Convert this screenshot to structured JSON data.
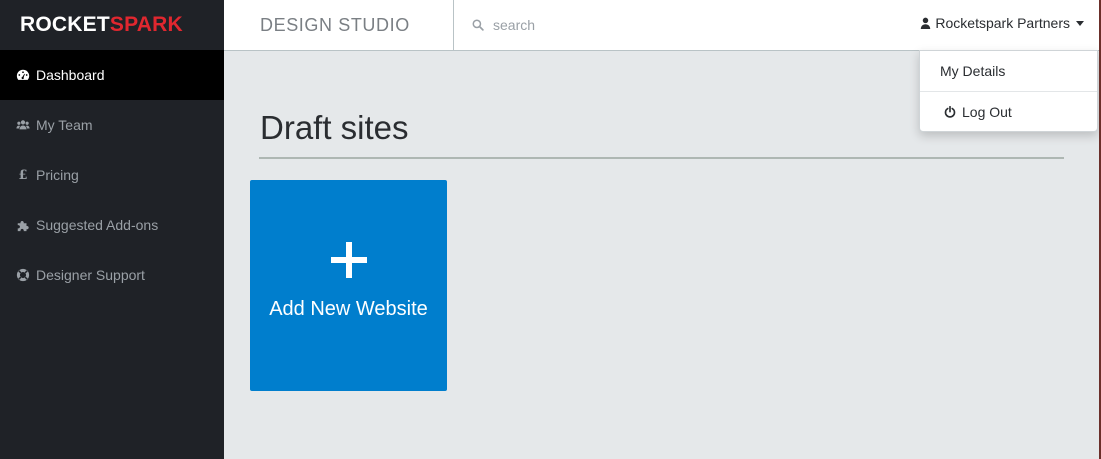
{
  "logo": {
    "part1": "ROCKET",
    "part2": "SPARK"
  },
  "sidebar": {
    "items": [
      {
        "label": "Dashboard",
        "icon": "dashboard-icon"
      },
      {
        "label": "My Team",
        "icon": "team-icon"
      },
      {
        "label": "Pricing",
        "icon": "pound-icon"
      },
      {
        "label": "Suggested Add-ons",
        "icon": "puzzle-icon"
      },
      {
        "label": "Designer Support",
        "icon": "lifebuoy-icon"
      }
    ]
  },
  "header": {
    "section_title": "DESIGN STUDIO",
    "search_placeholder": "search",
    "user_name": "Rocketspark Partners"
  },
  "dropdown": {
    "my_details": "My Details",
    "log_out": "Log Out"
  },
  "main": {
    "heading": "Draft sites",
    "add_card_label": "Add New Website"
  },
  "colors": {
    "sidebar_bg": "#1f2227",
    "brand_red": "#e0272f",
    "accent_blue": "#007ecd",
    "content_bg": "#e5e8ea"
  }
}
